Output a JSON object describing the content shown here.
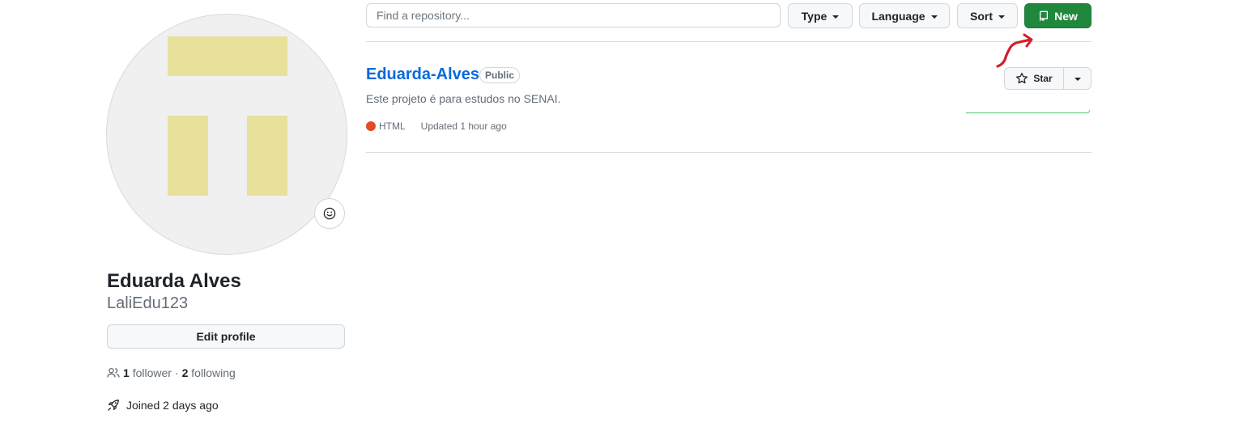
{
  "profile": {
    "fullname": "Eduarda Alves",
    "username": "LaliEdu123",
    "edit_profile_label": "Edit profile",
    "followers_count": "1",
    "followers_label": "follower",
    "separator": "·",
    "following_count": "2",
    "following_label": "following",
    "joined_text": "Joined 2 days ago"
  },
  "toolbar": {
    "search_placeholder": "Find a repository...",
    "search_value": "",
    "type_label": "Type",
    "language_label": "Language",
    "sort_label": "Sort",
    "new_label": "New"
  },
  "repo": {
    "name": "Eduarda-Alves",
    "visibility": "Public",
    "description": "Este projeto é para estudos no SENAI.",
    "language": "HTML",
    "language_color": "#e34c26",
    "updated": "Updated 1 hour ago",
    "star_label": "Star"
  },
  "colors": {
    "accent_green": "#1f883d",
    "link_blue": "#0969da",
    "annotation_red": "#d0202a",
    "avatar_yellow": "#e7e19c"
  }
}
